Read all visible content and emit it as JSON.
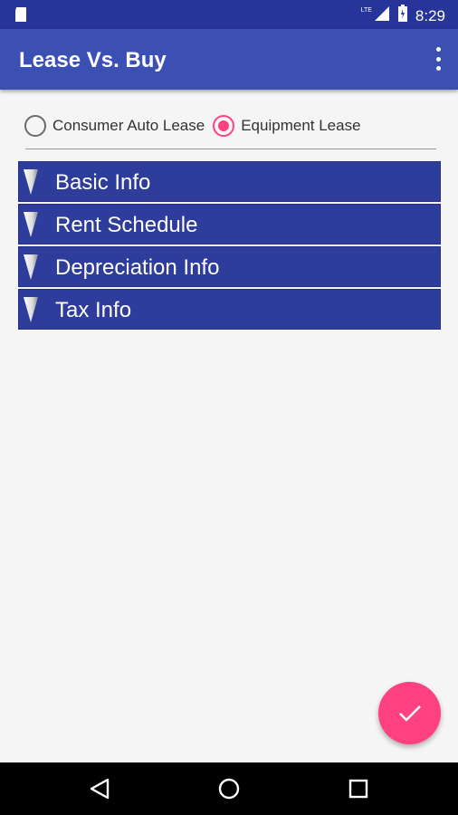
{
  "status_bar": {
    "time": "8:29",
    "network_label": "LTE",
    "icons": [
      "sd-card-icon",
      "signal-icon",
      "battery-icon"
    ]
  },
  "app_bar": {
    "title": "Lease Vs. Buy",
    "overflow_icon": "more-vert-icon"
  },
  "lease_type": {
    "options": [
      {
        "label": "Consumer Auto Lease",
        "selected": false
      },
      {
        "label": "Equipment Lease",
        "selected": true
      }
    ]
  },
  "sections": [
    {
      "label": "Basic Info"
    },
    {
      "label": "Rent Schedule"
    },
    {
      "label": "Depreciation Info"
    },
    {
      "label": "Tax Info"
    }
  ],
  "fab": {
    "icon": "check-icon"
  },
  "nav_bar": {
    "icons": [
      "back-icon",
      "home-icon",
      "recents-icon"
    ]
  },
  "colors": {
    "status_bar": "#27349a",
    "app_bar": "#3c50b4",
    "section_header": "#2e3c9c",
    "accent": "#ff4081",
    "background": "#f5f5f5"
  }
}
